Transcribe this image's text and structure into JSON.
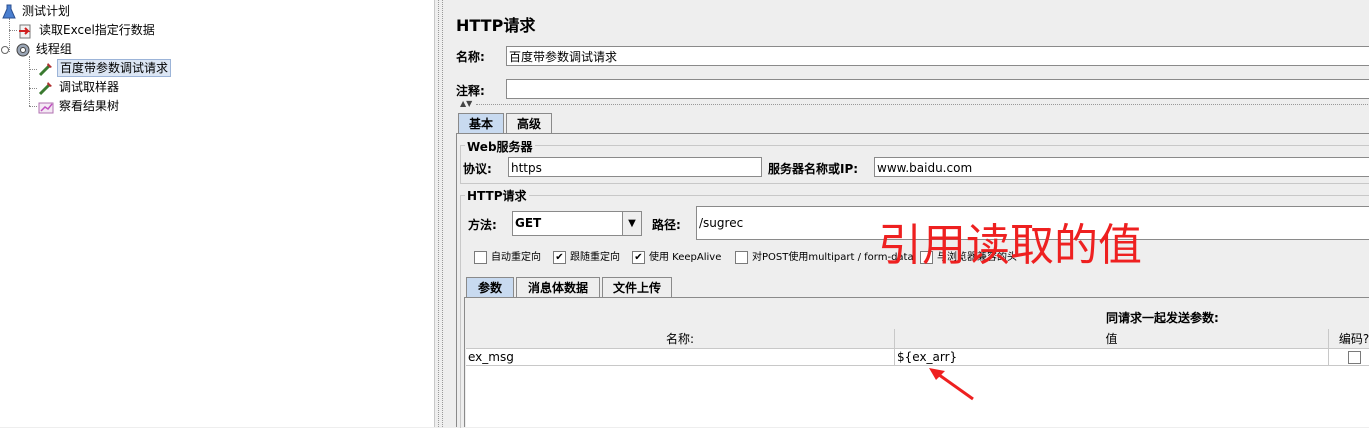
{
  "tree": {
    "items": [
      {
        "label": "测试计划",
        "icon": "flask-icon"
      },
      {
        "label": "读取Excel指定行数据",
        "icon": "config-arrow-icon"
      },
      {
        "label": "线程组",
        "icon": "gear-icon"
      },
      {
        "label": "百度带参数调试请求",
        "icon": "pipette-icon"
      },
      {
        "label": "调试取样器",
        "icon": "pipette-icon"
      },
      {
        "label": "察看结果树",
        "icon": "chart-icon"
      }
    ]
  },
  "sampler": {
    "title": "HTTP请求",
    "name_label": "名称:",
    "name_value": "百度带参数调试请求",
    "comment_label": "注释:",
    "comment_value": "",
    "tabs": [
      "基本",
      "高级"
    ],
    "web_server": {
      "legend": "Web服务器",
      "protocol_label": "协议:",
      "protocol_value": "https",
      "server_label": "服务器名称或IP:",
      "server_value": "www.baidu.com"
    },
    "http_request": {
      "legend": "HTTP请求",
      "method_label": "方法:",
      "method_value": "GET",
      "path_label": "路径:",
      "path_value": "/sugrec"
    },
    "checkboxes": [
      {
        "label": "自动重定向",
        "checked": false
      },
      {
        "label": "跟随重定向",
        "checked": true
      },
      {
        "label": "使用 KeepAlive",
        "checked": true
      },
      {
        "label": "对POST使用multipart / form-data",
        "checked": false
      },
      {
        "label": "与浏览器兼容的头",
        "checked": false
      }
    ],
    "param_tabs": [
      "参数",
      "消息体数据",
      "文件上传"
    ],
    "params_heading": "同请求一起发送参数:",
    "columns": [
      "名称:",
      "值",
      "编码?"
    ],
    "rows": [
      {
        "name": "ex_msg",
        "value": "${ex_arr}",
        "encode": false
      }
    ]
  },
  "annotation": {
    "text": "引用读取的值",
    "color": "#ee2020"
  }
}
